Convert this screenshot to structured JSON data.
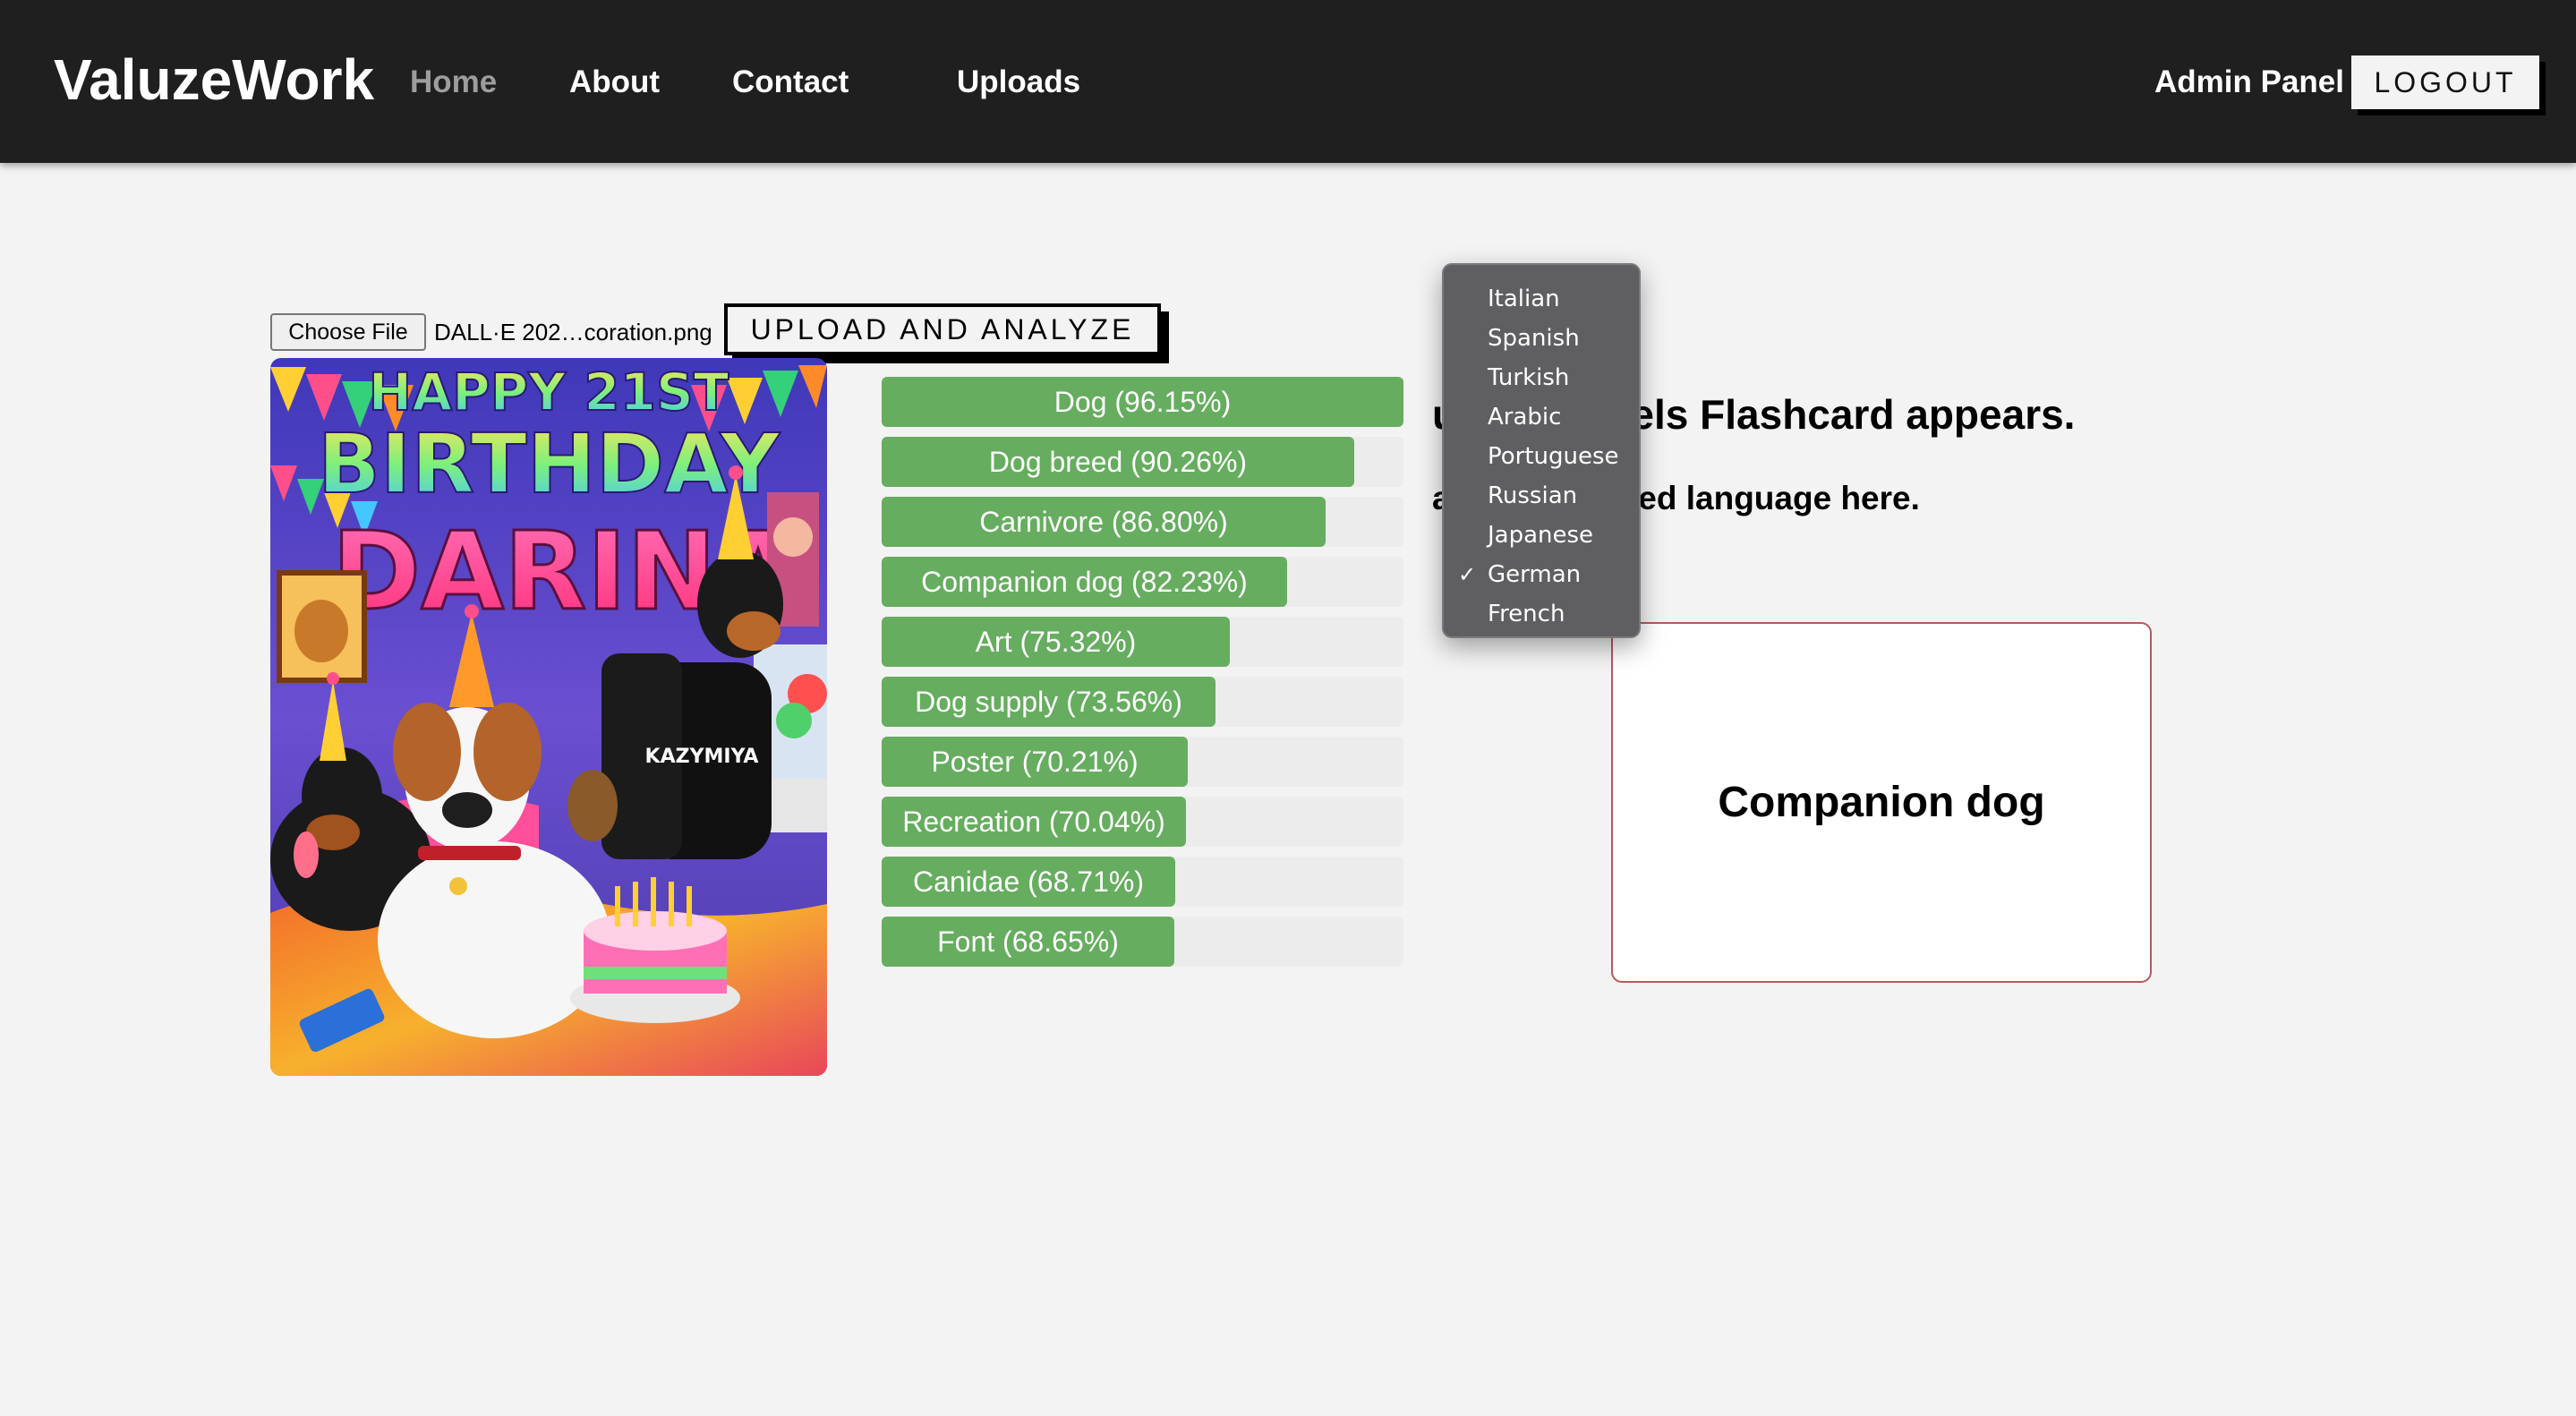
{
  "navbar": {
    "brand": "ValuzeWork",
    "links": [
      {
        "label": "Home",
        "active": true
      },
      {
        "label": "About",
        "active": false
      },
      {
        "label": "Contact",
        "active": false
      },
      {
        "label": "Uploads",
        "active": false
      }
    ],
    "admin_panel": "Admin Panel",
    "logout": "LOGOUT"
  },
  "upload": {
    "choose_file_label": "Choose File",
    "file_name": "DALL·E 202…coration.png",
    "upload_button": "UPLOAD AND ANALYZE"
  },
  "image": {
    "title_words": [
      "HAPPY 21ST",
      "BIRTHDAY",
      "DARINA"
    ],
    "shirt_text": "KAZYMIYA"
  },
  "labels": [
    {
      "text": "Dog (96.15%)",
      "score": 96.15
    },
    {
      "text": "Dog breed (90.26%)",
      "score": 90.26
    },
    {
      "text": "Carnivore (86.80%)",
      "score": 86.8
    },
    {
      "text": "Companion dog (82.23%)",
      "score": 82.23
    },
    {
      "text": "Art (75.32%)",
      "score": 75.32
    },
    {
      "text": "Dog supply (73.56%)",
      "score": 73.56
    },
    {
      "text": "Poster (70.21%)",
      "score": 70.21
    },
    {
      "text": "Recreation (70.04%)",
      "score": 70.04
    },
    {
      "text": "Canidae (68.71%)",
      "score": 68.71
    },
    {
      "text": "Font (68.65%)",
      "score": 68.65
    }
  ],
  "instructions": {
    "line1": "u click labels Flashcard appears.",
    "line2": "ange translated language here."
  },
  "flashcard": {
    "text": "Companion dog"
  },
  "language_menu": {
    "options": [
      {
        "label": "Italian",
        "selected": false
      },
      {
        "label": "Spanish",
        "selected": false
      },
      {
        "label": "Turkish",
        "selected": false
      },
      {
        "label": "Arabic",
        "selected": false
      },
      {
        "label": "Portuguese",
        "selected": false
      },
      {
        "label": "Russian",
        "selected": false
      },
      {
        "label": "Japanese",
        "selected": false
      },
      {
        "label": "German",
        "selected": true
      },
      {
        "label": "French",
        "selected": false
      }
    ],
    "check_glyph": "✓"
  },
  "colors": {
    "navbar_bg": "#1f1f1f",
    "page_bg": "#f3f3f3",
    "label_bar": "#66ad5f",
    "flashcard_border": "#b55a5a",
    "menu_bg": "#5f5e61"
  }
}
